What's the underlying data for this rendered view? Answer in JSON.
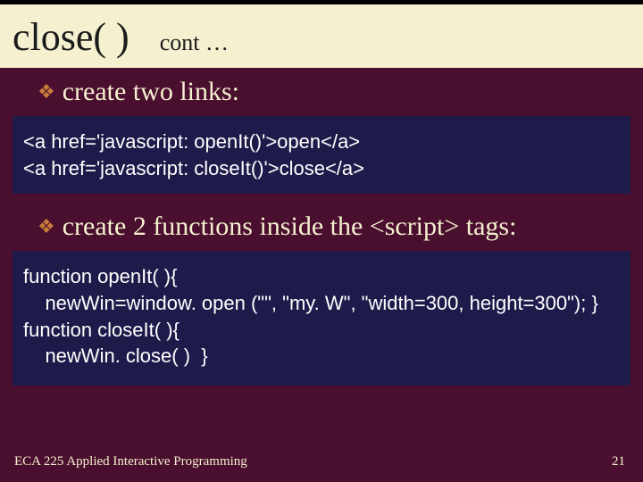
{
  "title": {
    "main": "close( )",
    "cont": "cont …"
  },
  "bullets": {
    "b1": "create two links:",
    "b2": "create 2 functions inside the <script> tags:"
  },
  "code": {
    "block1": "<a href='javascript: openIt()'>open</a>\n<a href='javascript: closeIt()'>close</a>",
    "block2": "function openIt( ){\n    newWin=window. open (\"\", \"my. W\", \"width=300, height=300\"); }\nfunction closeIt( ){\n    newWin. close( )  }"
  },
  "footer": {
    "left": "ECA 225   Applied Interactive Programming",
    "right": "21"
  }
}
